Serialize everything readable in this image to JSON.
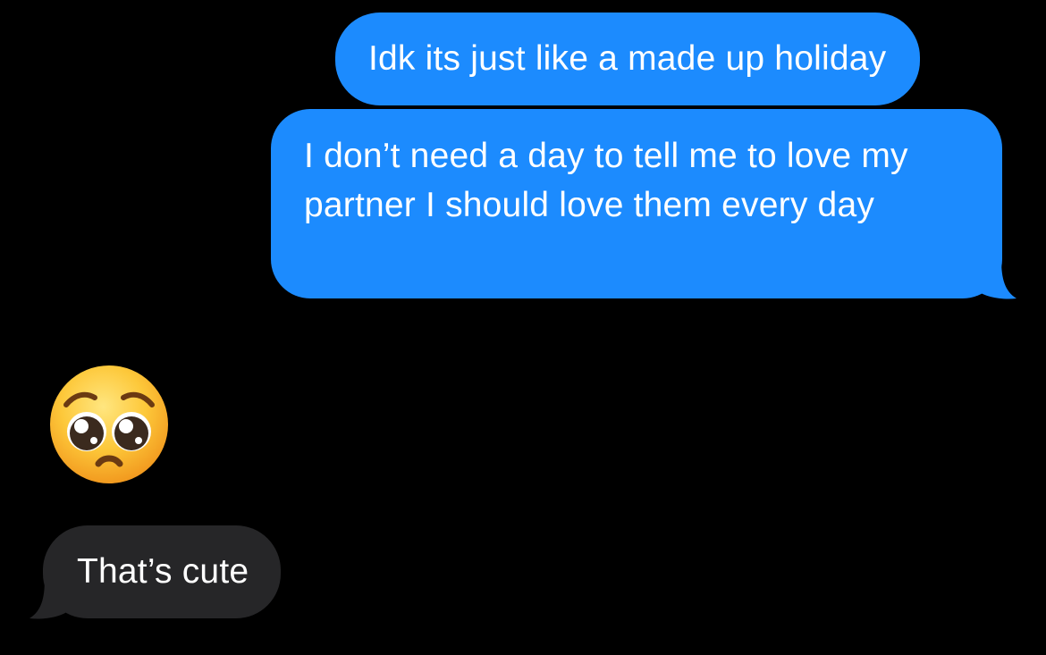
{
  "messages": [
    {
      "from": "me",
      "text": "Idk its just like a made up holiday"
    },
    {
      "from": "me",
      "text": "I don’t need a day to tell me to love my partner I should love them every day"
    },
    {
      "from": "them",
      "emoji": "pleading-face"
    },
    {
      "from": "them",
      "text": "That’s cute"
    }
  ],
  "colors": {
    "background": "#000000",
    "sent_bubble": "#1c8bfe",
    "received_bubble": "#262628",
    "text": "#ffffff"
  },
  "icons": {
    "reaction_emoji": "pleading-face-emoji"
  }
}
